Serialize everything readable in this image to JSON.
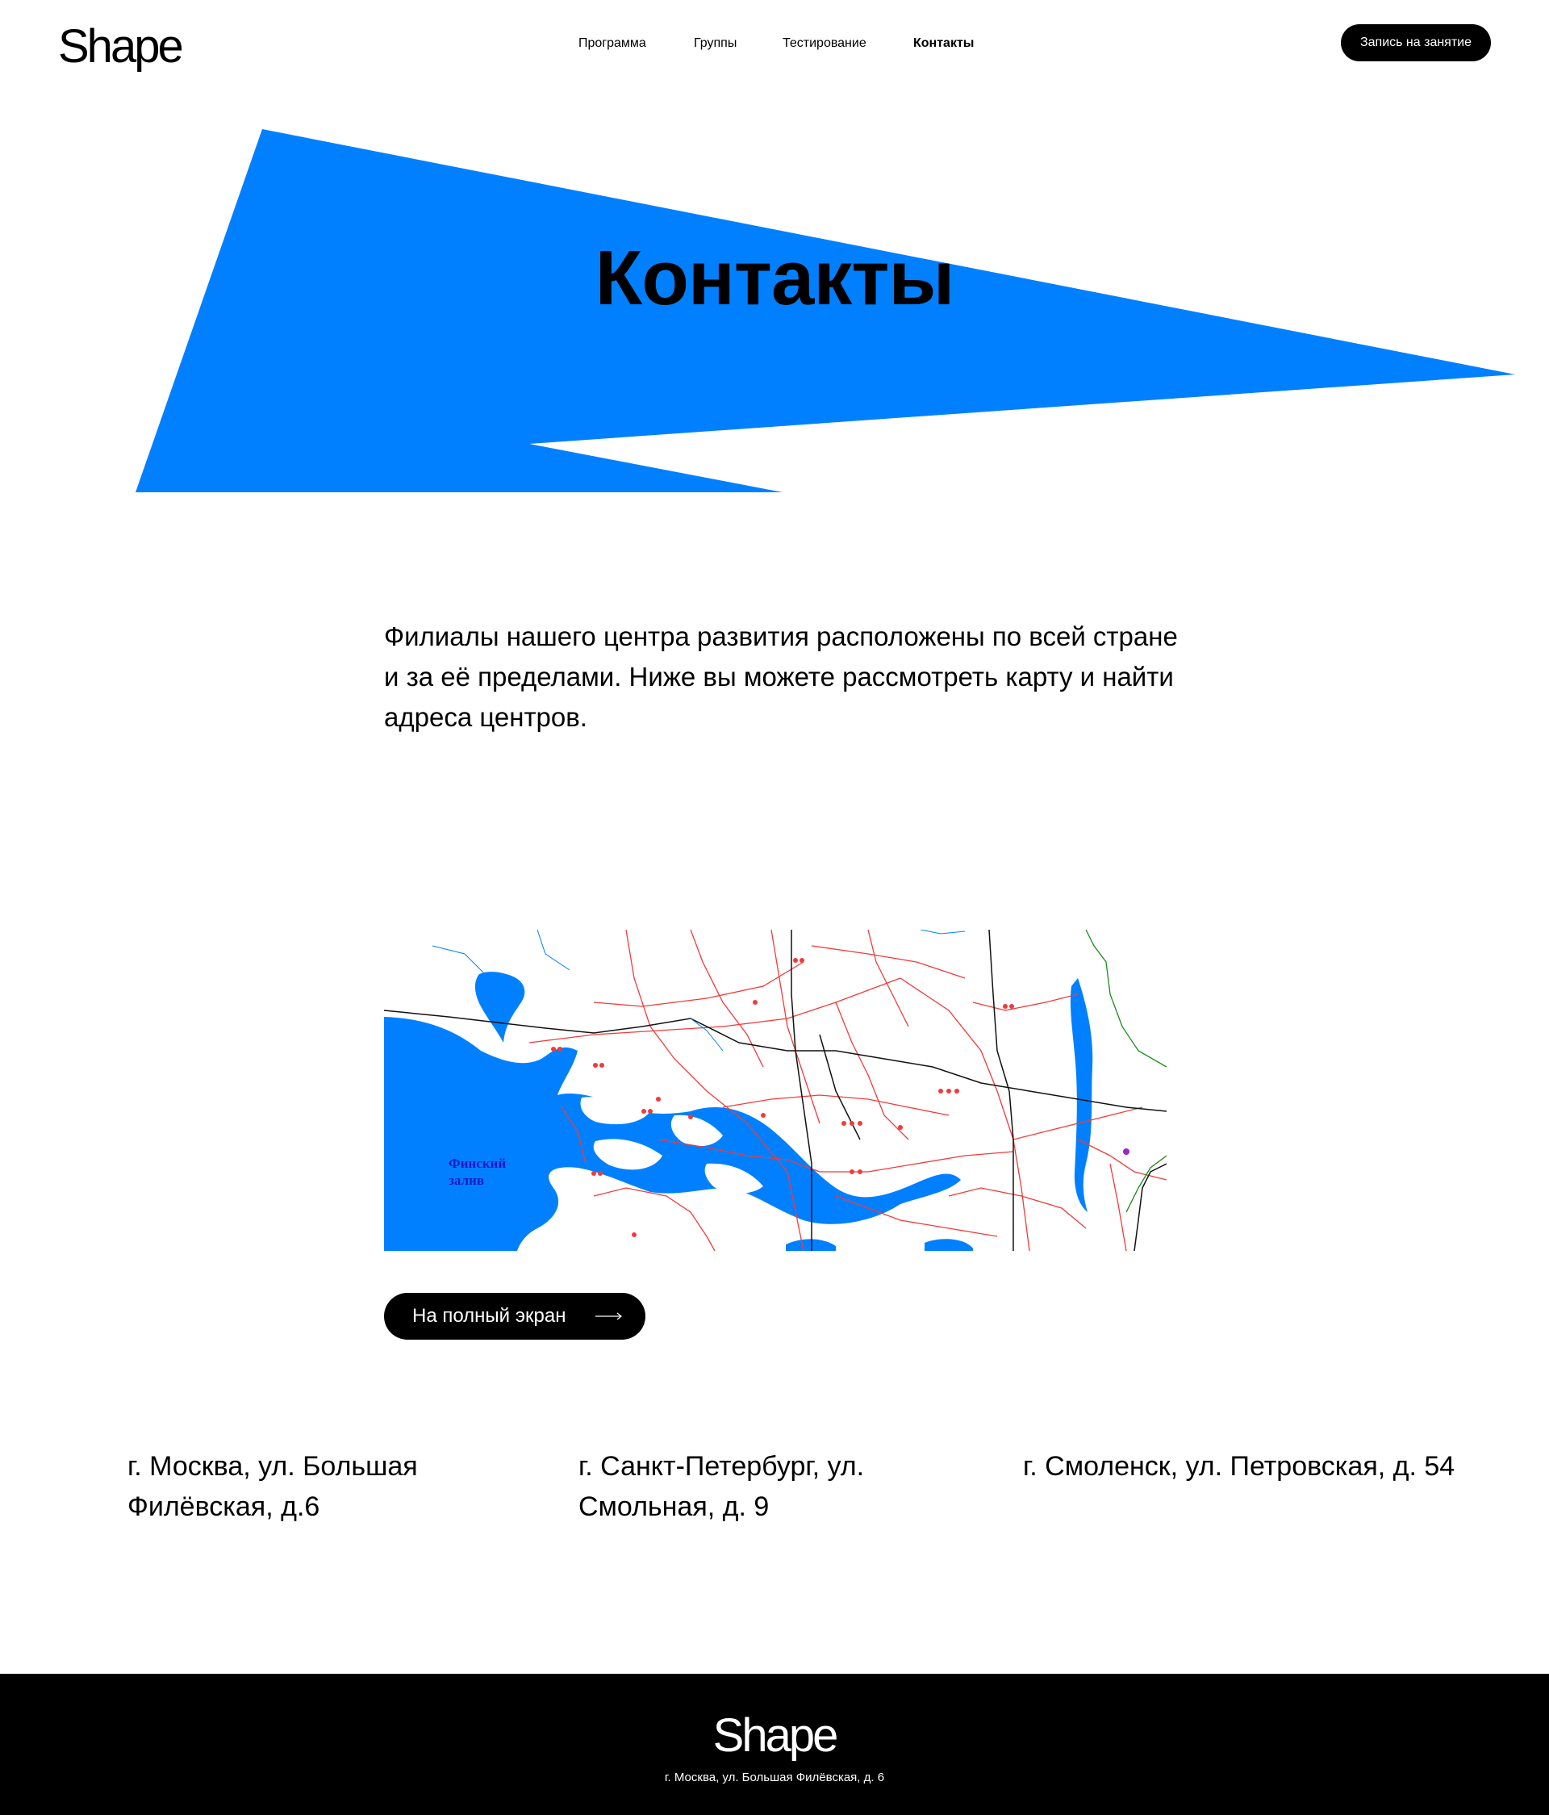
{
  "header": {
    "logo": "Shape",
    "nav": [
      {
        "label": "Программа",
        "active": false
      },
      {
        "label": "Группы",
        "active": false
      },
      {
        "label": "Тестирование",
        "active": false
      },
      {
        "label": "Контакты",
        "active": true
      }
    ],
    "cta_label": "Запись на занятие"
  },
  "hero": {
    "title": "Контакты",
    "accent_color": "#0080FF"
  },
  "intro": {
    "text": "Филиалы нашего центра развития расположены по всей стране и за её пределами. Ниже вы можете рассмотреть карту и найти адреса центров."
  },
  "map": {
    "water_label_line1": "Финский",
    "water_label_line2": "залив",
    "water_color": "#0080FF",
    "road_color": "#F23A3A",
    "rail_color": "#000000"
  },
  "fullscreen_button": {
    "label": "На полный экран",
    "icon": "arrow-right-icon"
  },
  "addresses": [
    {
      "text": "г. Москва, ул. Большая Филёвская, д.6"
    },
    {
      "text": "г. Санкт-Петербург, ул. Смольная, д. 9"
    },
    {
      "text": "г. Смоленск, ул. Петровская, д. 54"
    }
  ],
  "footer": {
    "logo": "Shape",
    "address": "г. Москва, ул. Большая Филёвская, д. 6"
  }
}
